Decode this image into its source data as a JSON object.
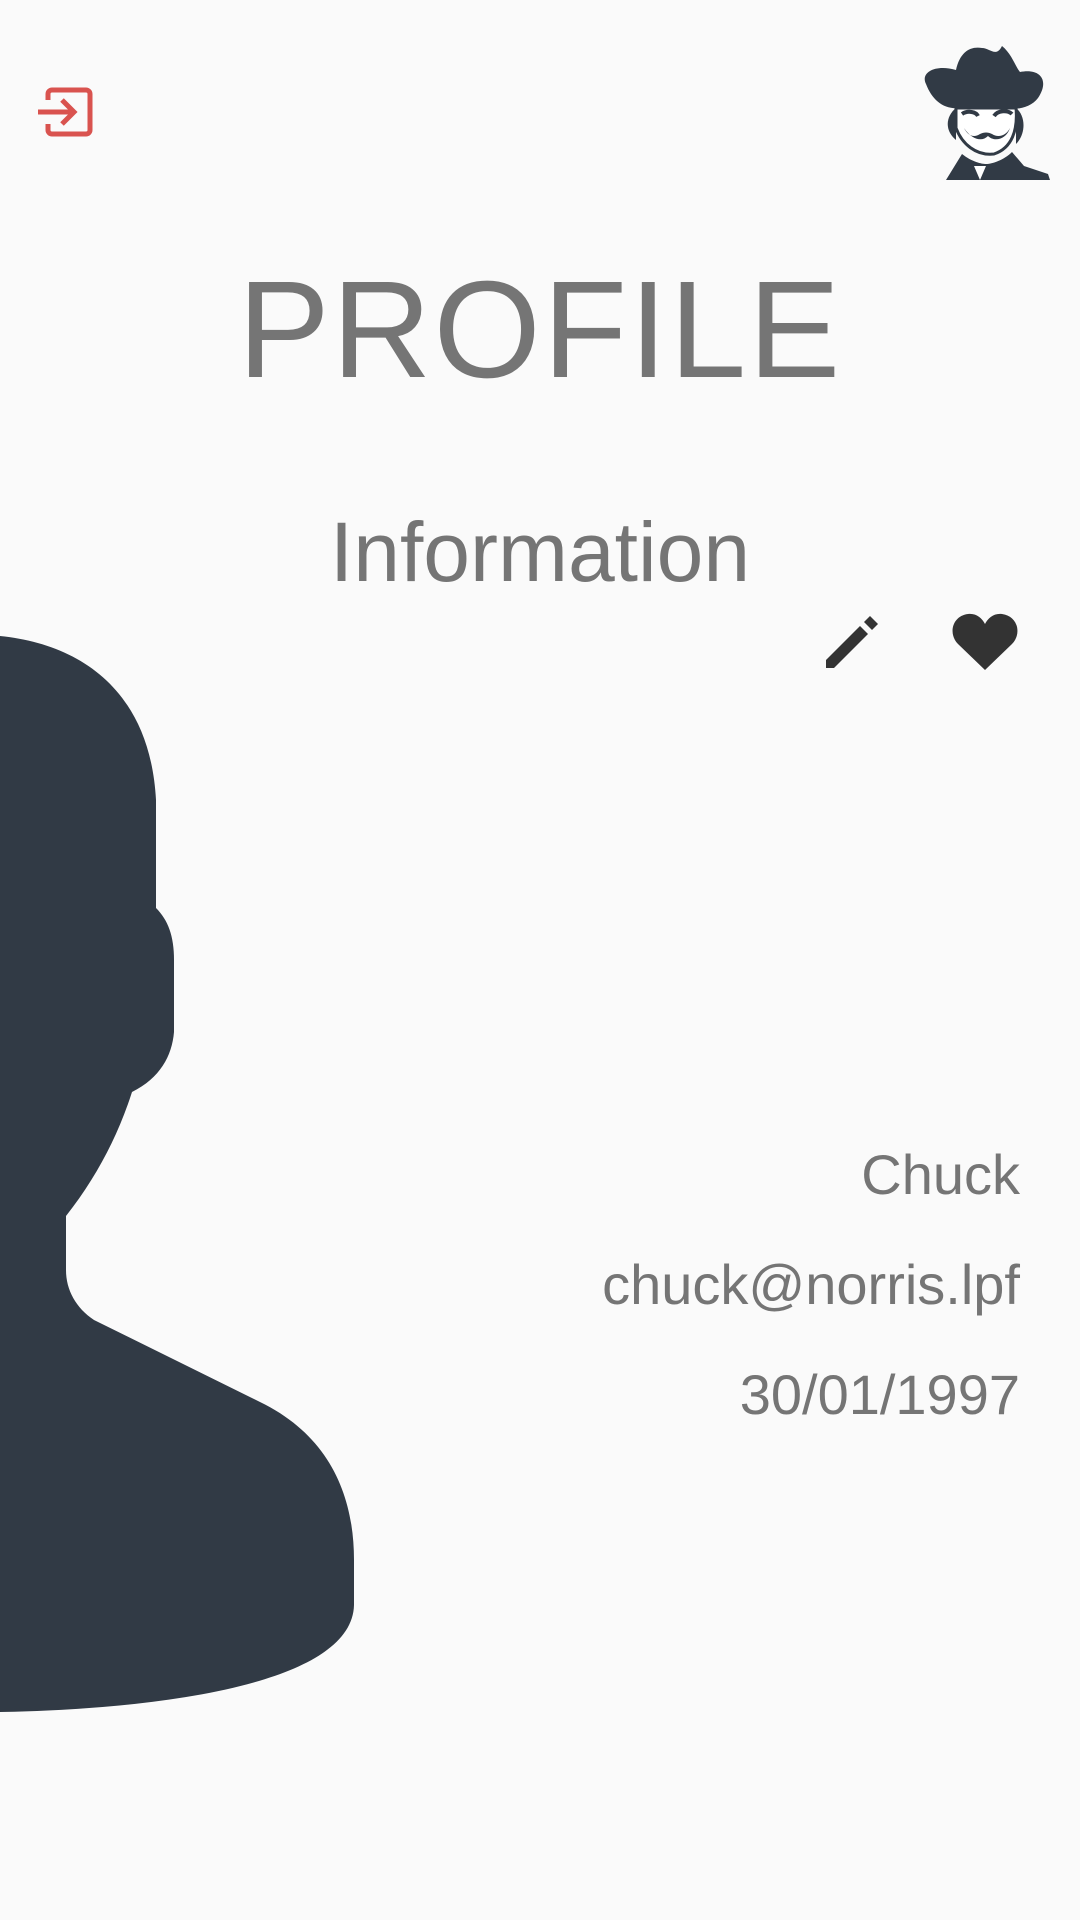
{
  "header": {
    "logout_icon": "sign-out-icon",
    "logo_icon": "cowboy-logo-icon",
    "accent_color": "#d9534f"
  },
  "page": {
    "title": "PROFILE",
    "section_title": "Information"
  },
  "actions": {
    "edit_icon": "pencil-icon",
    "favorite_icon": "heart-icon",
    "icon_color": "#333333"
  },
  "profile": {
    "avatar_icon": "person-silhouette-icon",
    "avatar_color": "#313a45",
    "name": "Chuck",
    "email": "chuck@norris.lpf",
    "birth_date": "30/01/1997"
  }
}
